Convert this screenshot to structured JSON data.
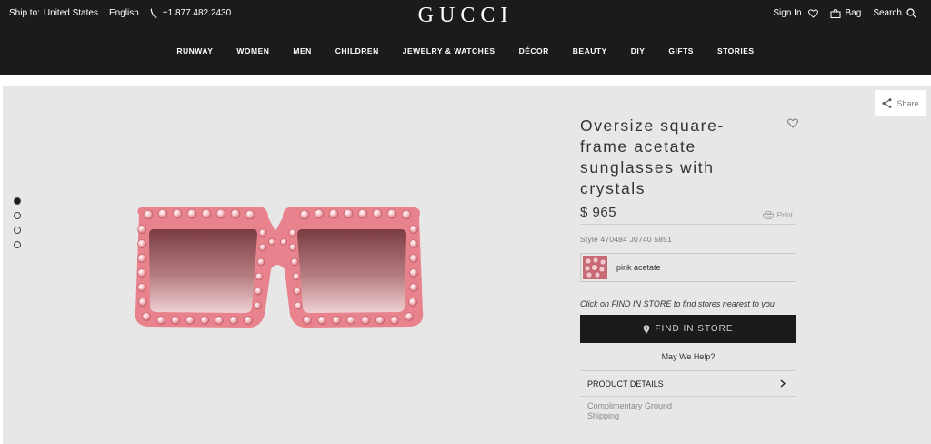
{
  "header": {
    "ship_label": "Ship to:",
    "ship_value": "United States",
    "language": "English",
    "phone": "+1.877.482.2430",
    "logo": "GUCCI",
    "sign_in": "Sign In",
    "bag": "Bag",
    "search": "Search",
    "nav": [
      "RUNWAY",
      "WOMEN",
      "MEN",
      "CHILDREN",
      "JEWELRY & WATCHES",
      "DÉCOR",
      "BEAUTY",
      "DIY",
      "GIFTS",
      "STORIES"
    ]
  },
  "product": {
    "title": "Oversize square-frame acetate sunglasses with crystals",
    "price": "$ 965",
    "print_label": "Print",
    "style": "Style 470484 J0740 5851",
    "swatch_label": "pink acetate",
    "find_hint": "Click on FIND IN STORE to find stores nearest to you",
    "find_button": "FIND IN STORE",
    "help": "May We Help?",
    "details_label": "PRODUCT DETAILS",
    "shipping": "Complimentary Ground Shipping",
    "share_label": "Share",
    "gallery_dots": 4,
    "active_dot": 0,
    "accent_pink": "#e8828c",
    "button_color": "#1b1b1b"
  },
  "icons": {
    "phone": "phone-icon",
    "wishlist": "heart-icon",
    "bag": "bag-icon",
    "search": "search-icon",
    "share": "share-icon",
    "print": "printer-icon",
    "pin": "map-pin-icon",
    "chevron": "chevron-right-icon"
  }
}
